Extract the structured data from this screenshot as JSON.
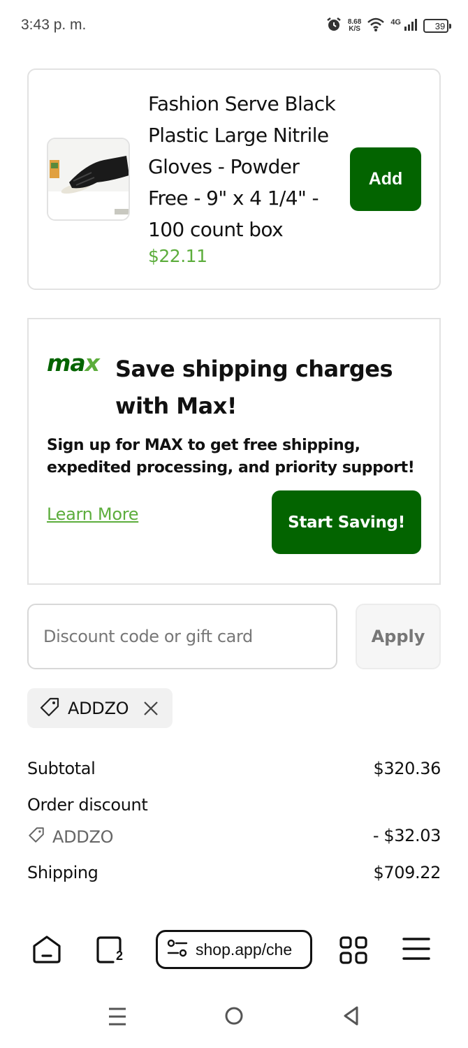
{
  "status_bar": {
    "time": "3:43 p. m.",
    "speed_value": "8.68",
    "speed_unit": "K/S",
    "network": "4G",
    "battery": "39",
    "icons": [
      "alarm-icon",
      "wifi-icon",
      "signal-icon",
      "battery-icon"
    ]
  },
  "product": {
    "title": "Fashion Serve Black Plastic Large Nitrile Gloves - Powder Free - 9\" x 4 1/4\" - 100 count box",
    "price": "$22.11",
    "add_label": "Add"
  },
  "promo": {
    "logo": "max",
    "title": "Save shipping charges with Max!",
    "body": "Sign up for MAX to get free shipping, expedited processing, and priority support!",
    "learn_more": "Learn More",
    "cta": "Start Saving!"
  },
  "discount": {
    "placeholder": "Discount code or gift card",
    "apply_label": "Apply",
    "applied_code": "ADDZO"
  },
  "summary": {
    "subtotal_label": "Subtotal",
    "subtotal_value": "$320.36",
    "order_discount_label": "Order discount",
    "discount_code": "ADDZO",
    "discount_value": "- $32.03",
    "shipping_label": "Shipping",
    "shipping_value": "$709.22"
  },
  "browser": {
    "url": "shop.app/che",
    "tab_count": "2"
  },
  "colors": {
    "brand_green": "#036400",
    "accent_green": "#5cad3c"
  }
}
